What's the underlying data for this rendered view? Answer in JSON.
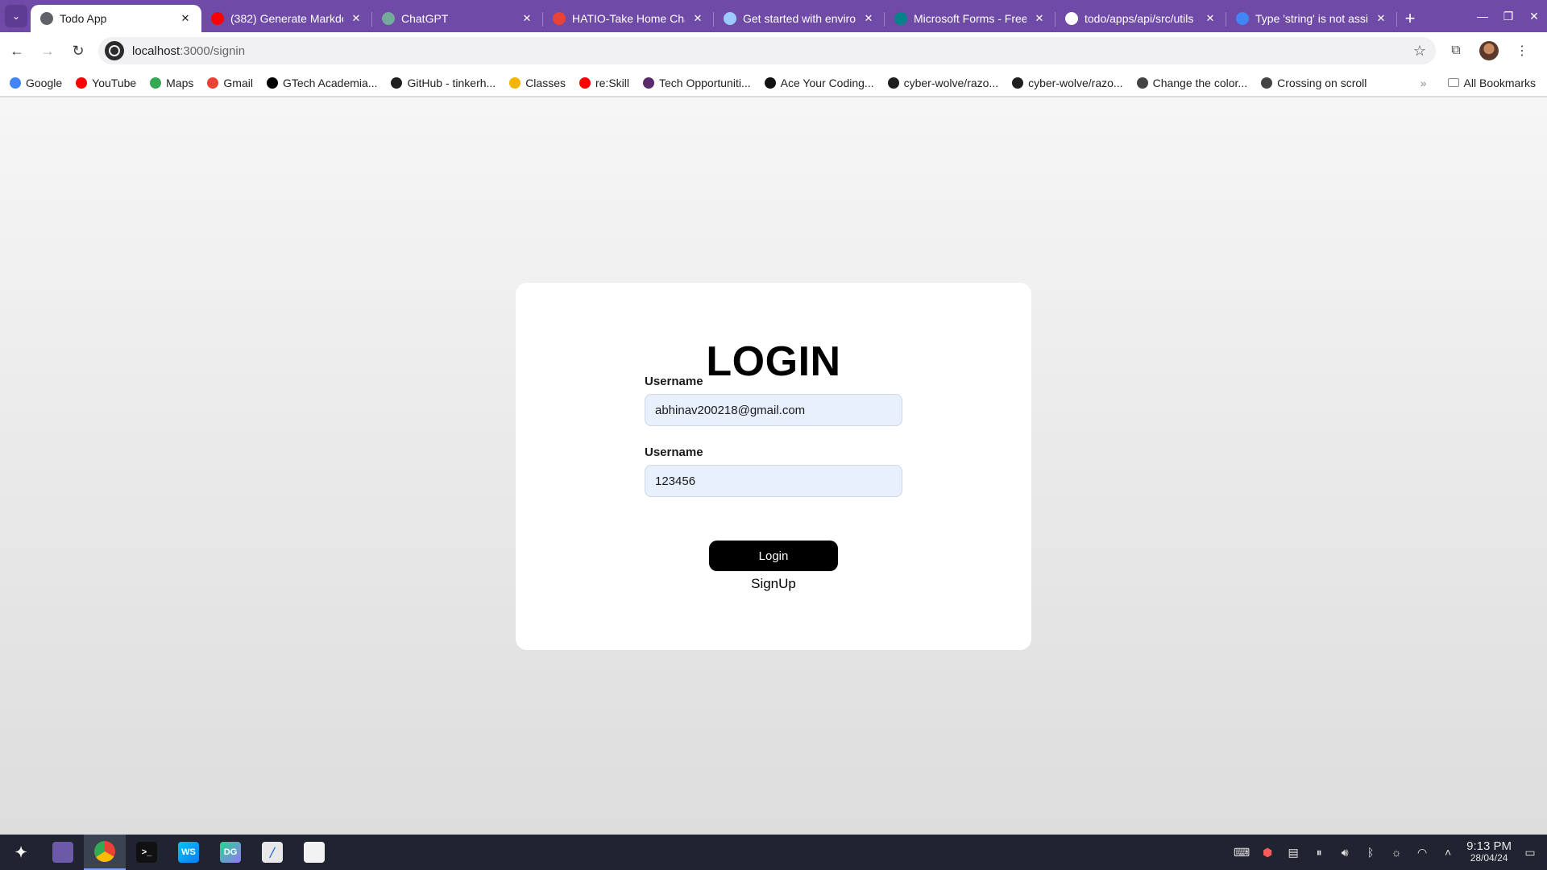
{
  "browser": {
    "tabs": [
      {
        "title": "Todo App",
        "icon": "globe-icon",
        "color": "#5f6368",
        "active": true
      },
      {
        "title": "(382) Generate Markdo",
        "icon": "youtube-icon",
        "color": "#ff0000"
      },
      {
        "title": "ChatGPT",
        "icon": "chatgpt-icon",
        "color": "#74aa9c"
      },
      {
        "title": "HATIO-Take Home Cha",
        "icon": "gmail-icon",
        "color": "#ea4335"
      },
      {
        "title": "Get started with enviro",
        "icon": "sparkle-icon",
        "color": "#9ecbff"
      },
      {
        "title": "Microsoft Forms - Free",
        "icon": "forms-icon",
        "color": "#038387"
      },
      {
        "title": "todo/apps/api/src/utils",
        "icon": "github-icon",
        "color": "#ffffff"
      },
      {
        "title": "Type 'string' is not assi",
        "icon": "google-icon",
        "color": "#4285f4"
      }
    ],
    "url_host": "localhost",
    "url_path": ":3000/signin",
    "bookmarks": [
      {
        "label": "Google",
        "icon": "google-icon",
        "color": "#4285f4"
      },
      {
        "label": "YouTube",
        "icon": "youtube-icon",
        "color": "#ff0000"
      },
      {
        "label": "Maps",
        "icon": "maps-icon",
        "color": "#34a853"
      },
      {
        "label": "Gmail",
        "icon": "gmail-icon",
        "color": "#ea4335"
      },
      {
        "label": "GTech Academia...",
        "icon": "x-icon",
        "color": "#000000"
      },
      {
        "label": "GitHub - tinkerh...",
        "icon": "github-icon",
        "color": "#1f1f1f"
      },
      {
        "label": "Classes",
        "icon": "classroom-icon",
        "color": "#f4b400"
      },
      {
        "label": "re:Skill",
        "icon": "youtube-icon",
        "color": "#ff0000"
      },
      {
        "label": "Tech Opportuniti...",
        "icon": "tech-icon",
        "color": "#5a2a6a"
      },
      {
        "label": "Ace Your Coding...",
        "icon": "coding-icon",
        "color": "#111111"
      },
      {
        "label": "cyber-wolve/razo...",
        "icon": "github-icon",
        "color": "#1f1f1f"
      },
      {
        "label": "cyber-wolve/razo...",
        "icon": "github-icon",
        "color": "#1f1f1f"
      },
      {
        "label": "Change the color...",
        "icon": "chatgpt-icon",
        "color": "#444444"
      },
      {
        "label": "Crossing on scroll",
        "icon": "chatgpt-icon",
        "color": "#444444"
      }
    ],
    "bookmarks_more": "»",
    "all_bookmarks": "All Bookmarks"
  },
  "login": {
    "heading": "LOGIN",
    "username_label": "Username",
    "username_value": "abhinav200218@gmail.com",
    "password_label": "Username",
    "password_value": "123456",
    "login_button": "Login",
    "signup_link": "SignUp"
  },
  "taskbar": {
    "time": "9:13 PM",
    "date": "28/04/24"
  }
}
